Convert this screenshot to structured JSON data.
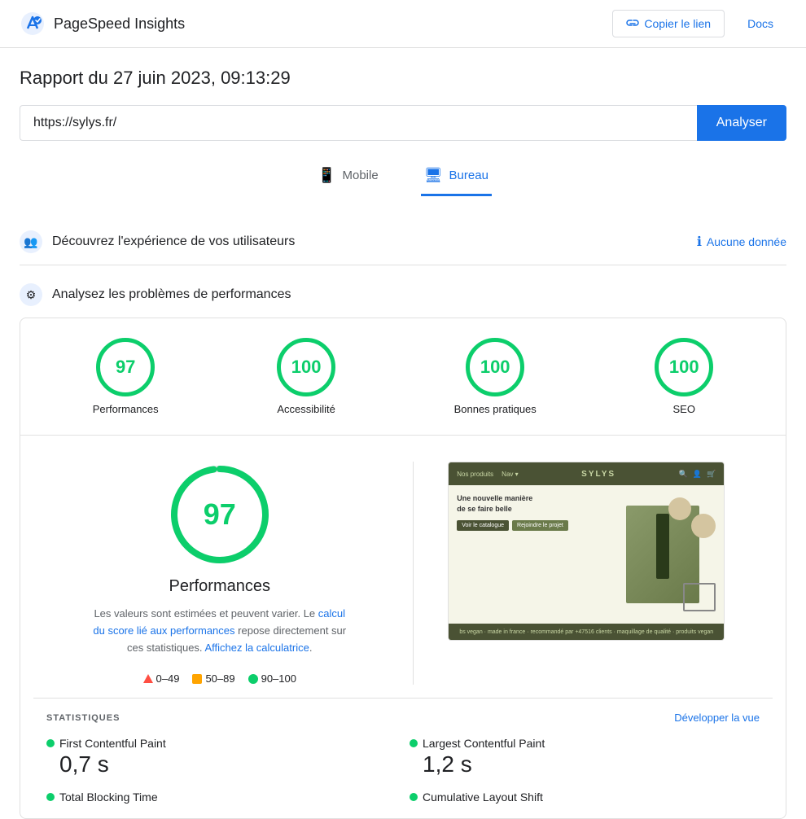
{
  "header": {
    "title": "PageSpeed Insights",
    "copy_link_label": "Copier le lien",
    "docs_label": "Docs"
  },
  "report": {
    "title": "Rapport du 27 juin 2023, 09:13:29",
    "url_value": "https://sylys.fr/",
    "analyze_label": "Analyser"
  },
  "tabs": [
    {
      "id": "mobile",
      "label": "Mobile",
      "active": false
    },
    {
      "id": "bureau",
      "label": "Bureau",
      "active": true
    }
  ],
  "user_experience": {
    "icon": "👥",
    "title": "Découvrez l'expérience de vos utilisateurs",
    "no_data_label": "Aucune donnée"
  },
  "performance_analysis": {
    "icon": "⚙️",
    "title": "Analysez les problèmes de performances"
  },
  "scores": [
    {
      "label": "Performances",
      "value": "97",
      "color": "green"
    },
    {
      "label": "Accessibilité",
      "value": "100",
      "color": "green"
    },
    {
      "label": "Bonnes pratiques",
      "value": "100",
      "color": "green"
    },
    {
      "label": "SEO",
      "value": "100",
      "color": "green"
    }
  ],
  "performance_detail": {
    "big_score": "97",
    "title": "Performances",
    "description_start": "Les valeurs sont estimées et peuvent varier. Le",
    "description_link1": "calcul du score lié aux performances",
    "description_middle": "repose directement sur ces statistiques.",
    "description_link2": "Affichez la calculatrice",
    "description_end": ".",
    "legend": [
      {
        "type": "triangle",
        "range": "0–49"
      },
      {
        "type": "square",
        "range": "50–89"
      },
      {
        "type": "dot",
        "range": "90–100"
      }
    ]
  },
  "stats": {
    "title": "STATISTIQUES",
    "expand_label": "Développer la vue",
    "items": [
      {
        "name": "First Contentful Paint",
        "value": "0,7 s",
        "color": "green"
      },
      {
        "name": "Largest Contentful Paint",
        "value": "1,2 s",
        "color": "green"
      },
      {
        "name": "Total Blocking Time",
        "value": "",
        "color": "green"
      },
      {
        "name": "Cumulative Layout Shift",
        "value": "",
        "color": "green"
      }
    ]
  },
  "colors": {
    "green": "#0cce6b",
    "orange": "#ffa400",
    "red": "#ff4e42",
    "blue": "#1a73e8"
  }
}
